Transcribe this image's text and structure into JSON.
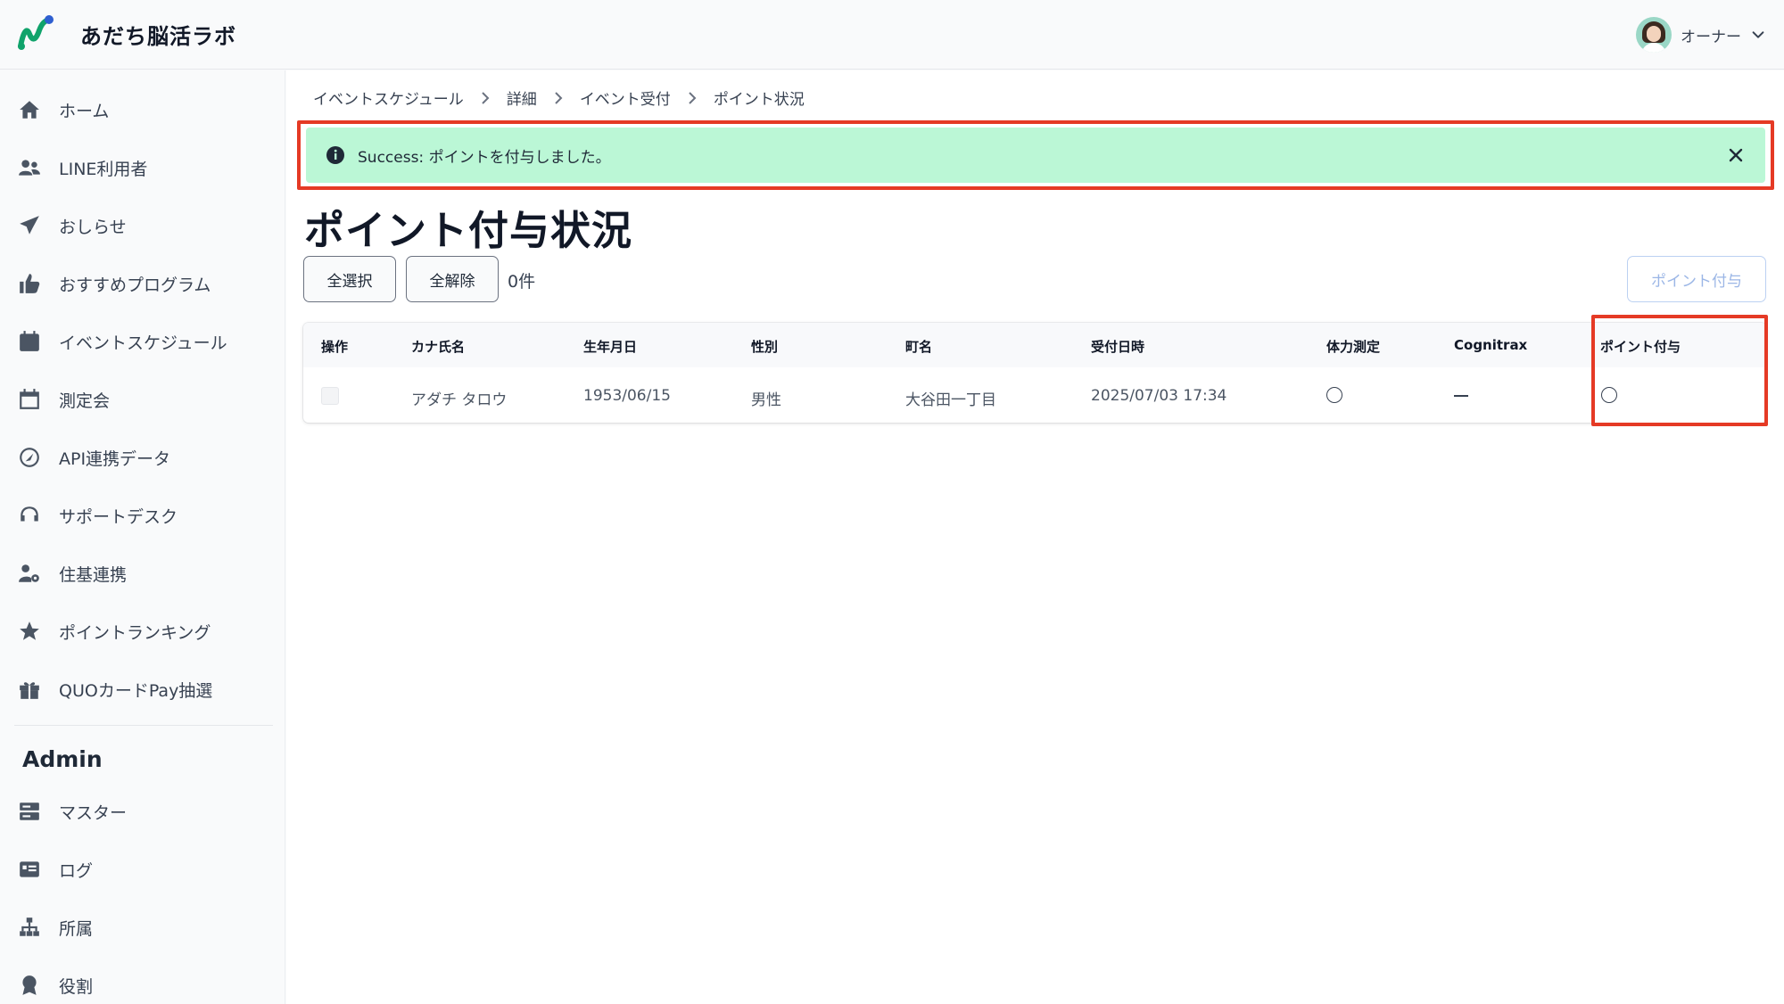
{
  "header": {
    "app_title": "あだち脳活ラボ",
    "user_name": "オーナー"
  },
  "sidebar": {
    "items": [
      {
        "label": "ホーム",
        "icon": "home-icon"
      },
      {
        "label": "LINE利用者",
        "icon": "users-icon"
      },
      {
        "label": "おしらせ",
        "icon": "paper-plane-icon"
      },
      {
        "label": "おすすめプログラム",
        "icon": "thumbs-up-icon"
      },
      {
        "label": "イベントスケジュール",
        "icon": "calendar-filled-icon"
      },
      {
        "label": "測定会",
        "icon": "calendar-outline-icon"
      },
      {
        "label": "API連携データ",
        "icon": "api-icon"
      },
      {
        "label": "サポートデスク",
        "icon": "headset-icon"
      },
      {
        "label": "住基連携",
        "icon": "user-gear-icon"
      },
      {
        "label": "ポイントランキング",
        "icon": "star-icon"
      },
      {
        "label": "QUOカードPay抽選",
        "icon": "gift-icon"
      }
    ],
    "admin_heading": "Admin",
    "admin_items": [
      {
        "label": "マスター",
        "icon": "server-icon"
      },
      {
        "label": "ログ",
        "icon": "log-icon"
      },
      {
        "label": "所属",
        "icon": "sitemap-icon"
      },
      {
        "label": "役割",
        "icon": "award-icon"
      }
    ]
  },
  "breadcrumb": [
    "イベントスケジュール",
    "詳細",
    "イベント受付",
    "ポイント状況"
  ],
  "alert": {
    "message": "Success: ポイントを付与しました。"
  },
  "page": {
    "title": "ポイント付与状況",
    "select_all_label": "全選択",
    "deselect_all_label": "全解除",
    "selected_count": "0件",
    "grant_button_label": "ポイント付与"
  },
  "table": {
    "columns": [
      "操作",
      "カナ氏名",
      "生年月日",
      "性別",
      "町名",
      "受付日時",
      "体力測定",
      "Cognitrax",
      "ポイント付与"
    ],
    "rows": [
      {
        "kana_name": "アダチ タロウ",
        "birth_date": "1953/06/15",
        "gender": "男性",
        "town": "大谷田一丁目",
        "received_at": "2025/07/03 17:34",
        "fitness": "○",
        "cognitrax": "—",
        "points_granted": "○"
      }
    ]
  },
  "colors": {
    "alert_bg": "#bbf7d6",
    "highlight_outline": "#e53a25",
    "accent": "#2563eb"
  }
}
